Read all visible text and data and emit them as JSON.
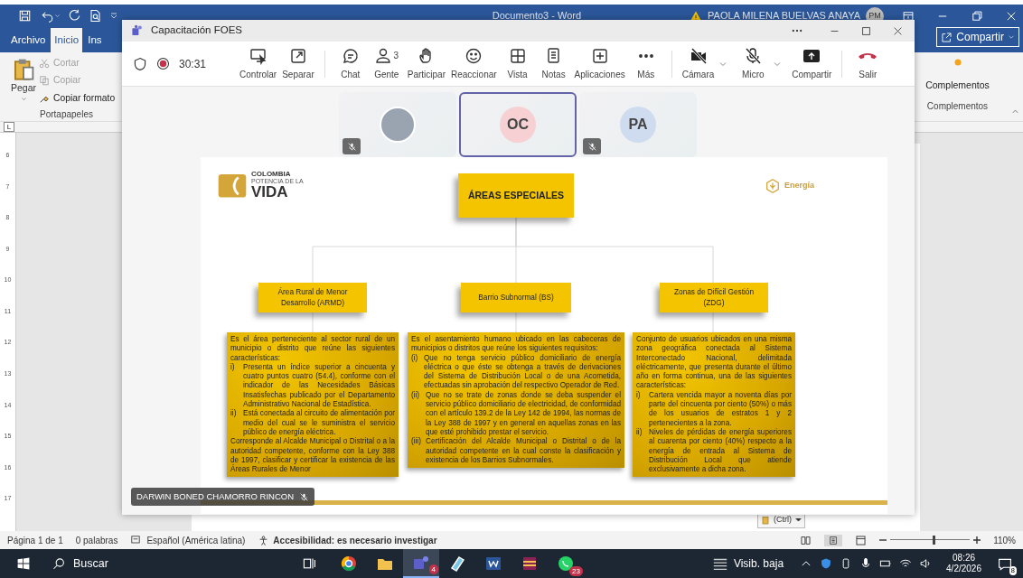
{
  "word": {
    "title": "Documento3  -  Word",
    "user": "PAOLA MILENA BUELVAS ANAYA",
    "user_initials": "PM",
    "tabs": [
      {
        "label": "Archivo",
        "selected": false
      },
      {
        "label": "Inicio",
        "selected": true
      },
      {
        "label": "Ins",
        "selected": false
      }
    ],
    "share": "Compartir",
    "clipboard": {
      "paste": "Pegar",
      "items": [
        {
          "label": "Cortar",
          "disabled": true
        },
        {
          "label": "Copiar",
          "disabled": true
        },
        {
          "label": "Copiar formato",
          "disabled": false
        }
      ],
      "group": "Portapapeles"
    },
    "addins": {
      "label": "Complementos",
      "group": "Complementos"
    },
    "ruler": [
      "6",
      "7",
      "8",
      "9",
      "10",
      "11",
      "12",
      "13",
      "14",
      "15",
      "16",
      "17"
    ],
    "tab_selector": "L",
    "paste_options": "(Ctrl)",
    "status_bar": {
      "page": "Página 1 de 1",
      "words": "0 palabras",
      "language": "Español (América latina)",
      "accessibility": "Accesibilidad: es necesario investigar",
      "zoom_slider": {
        "level": 0.55
      },
      "zoom": "110%"
    }
  },
  "teams": {
    "title": "Capacitación FOES",
    "timer": "30:31",
    "tools": [
      {
        "label": "Controlar"
      },
      {
        "label": "Separar"
      },
      {
        "label": "Chat"
      },
      {
        "label": "Gente",
        "count": "3"
      },
      {
        "label": "Participar"
      },
      {
        "label": "Reaccionar"
      },
      {
        "label": "Vista"
      },
      {
        "label": "Notas"
      },
      {
        "label": "Aplicaciones"
      },
      {
        "label": "Más"
      }
    ],
    "devices": [
      {
        "label": "Cámara",
        "on": false
      },
      {
        "label": "Micro",
        "on": false
      }
    ],
    "share": "Compartir",
    "leave": "Salir",
    "tiles": [
      {
        "kind": "photo",
        "muted": true,
        "selected": false
      },
      {
        "kind": "initials",
        "initials": "OC",
        "color": "#f6d0d2",
        "muted": false,
        "selected": true
      },
      {
        "kind": "initials",
        "initials": "PA",
        "color": "#cfdcf0",
        "muted": true,
        "selected": false
      }
    ],
    "presenter": {
      "name": "DARWIN BONED CHAMORRO RINCON",
      "muted": true
    }
  },
  "slide": {
    "logo": {
      "line1": "COLOMBIA",
      "line2": "POTENCIA DE LA",
      "line3": "VIDA"
    },
    "brand": "Energía",
    "root": "ÁREAS ESPECIALES",
    "branches": [
      {
        "title": "Área Rural de Menor Desarrollo (ARMD)",
        "intro": "Es el área perteneciente al sector rural de un municipio o distrito que reúne las siguientes características:",
        "items": [
          {
            "marker": "i)",
            "text": "Presenta un índice superior a cincuenta y cuatro puntos cuatro (54.4), conforme con el indicador de las Necesidades Básicas Insatisfechas publicado por el Departamento Administrativo Nacional de Estadística."
          },
          {
            "marker": "ii)",
            "text": "Está conectada al circuito de alimentación por medio del cual se le suministra el servicio público de energía eléctrica."
          }
        ],
        "outro": "Corresponde al Alcalde Municipal o Distrital o a la autoridad competente, conforme con la Ley 388 de 1997, clasificar y certificar la existencia de las Áreas Rurales de Menor"
      },
      {
        "title": "Barrio Subnormal (BS)",
        "intro": "Es el asentamiento humano ubicado en las cabeceras de municipios o distritos que reúne los siguientes requisitos:",
        "items": [
          {
            "marker": "(i)",
            "text": "Que no tenga servicio público domiciliario de energía eléctrica o que éste se obtenga a través de derivaciones del Sistema de Distribución Local o de una Acometida, efectuadas sin aprobación del respectivo Operador de Red."
          },
          {
            "marker": "(ii)",
            "text": "Que no se trate de zonas donde se deba suspender el servicio público domiciliario de electricidad, de conformidad con el artículo 139.2 de la Ley 142 de 1994, las normas de la Ley 388 de 1997 y en general en aquellas zonas en las que esté prohibido prestar el servicio."
          },
          {
            "marker": "(iii)",
            "text": "Certificación del Alcalde Municipal o Distrital o de la autoridad competente en la cual conste la clasificación y existencia de los Barrios Subnormales."
          }
        ]
      },
      {
        "title": "Zonas de Difícil Gestión (ZDG)",
        "intro": "Conjunto de usuarios ubicados en una misma zona geográfica conectada al Sistema Interconectado Nacional, delimitada eléctricamente, que presenta durante el último año en forma continua, una de las siguientes características:",
        "items": [
          {
            "marker": "i)",
            "text": "Cartera vencida mayor a noventa días por parte del cincuenta por ciento (50%) o más de los usuarios de estratos 1 y 2 pertenecientes a la zona."
          },
          {
            "marker": "ii)",
            "text": "Niveles de pérdidas de energía superiores al cuarenta por ciento (40%) respecto a la energía de entrada al Sistema de Distribución Local que atiende exclusivamente a dicha zona."
          }
        ]
      }
    ]
  },
  "taskbar": {
    "search": "Buscar",
    "apps": [
      {
        "selected": false
      },
      {
        "selected": false
      },
      {
        "selected": true,
        "badge": "4"
      },
      {
        "selected": false
      },
      {
        "selected": false
      },
      {
        "selected": false
      },
      {
        "selected": false,
        "badge": "23"
      }
    ],
    "weather": "Visib. baja",
    "time": "08:26",
    "date": "4/2/2026",
    "notifications": "8"
  }
}
